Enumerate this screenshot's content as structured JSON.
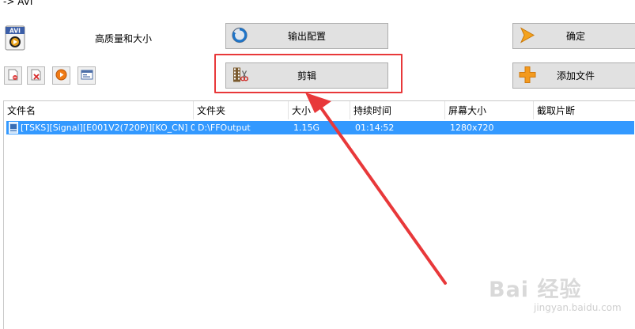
{
  "window": {
    "title": "-> AVI"
  },
  "format": {
    "icon_text": "AVI",
    "quality_label": "高质量和大小"
  },
  "buttons": {
    "output_config": "输出配置",
    "edit": "剪辑",
    "ok": "确定",
    "add_file": "添加文件"
  },
  "toolbar": {
    "items": [
      "remove-file-icon",
      "clear-list-icon",
      "play-icon",
      "file-info-icon"
    ]
  },
  "list": {
    "columns": [
      "文件名",
      "文件夹",
      "大小",
      "持续时间",
      "屏幕大小",
      "截取片断"
    ],
    "rows": [
      {
        "name": "[TSKS][Signal][E001V2(720P)][KO_CN] 00...",
        "folder": "D:\\FFOutput",
        "size": "1.15G",
        "duration": "01:14:52",
        "screen": "1280x720",
        "clip": ""
      }
    ]
  },
  "annotation": {
    "highlight_color": "#e8383a"
  },
  "watermark": {
    "logo": "Bai 经验",
    "url": "jingyan.baidu.com"
  }
}
